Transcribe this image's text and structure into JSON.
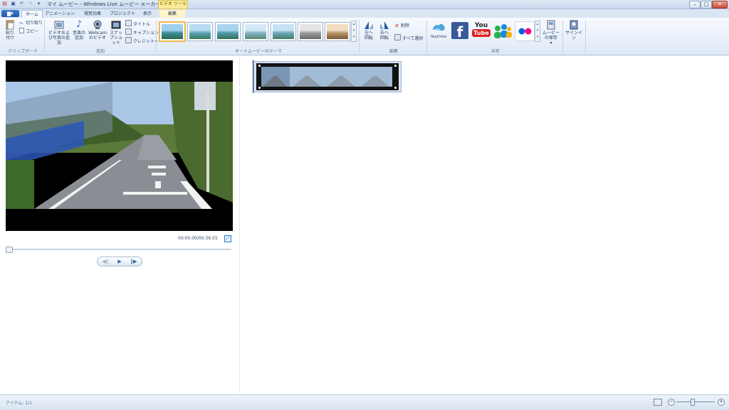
{
  "window": {
    "title": "マイ ムービー - Windows Live ムービー メーカー",
    "context_tab": "ビデオ ツール",
    "controls": {
      "minimize": "–",
      "maximize": "□",
      "close": "✕"
    }
  },
  "quick_access": {
    "save": "▣",
    "undo": "↶",
    "redo": "↷",
    "customize": "▾"
  },
  "tabs": {
    "file": "▆▾",
    "home": "ホーム",
    "animations": "アニメーション",
    "visual_effects": "視覚効果",
    "project": "プロジェクト",
    "view": "表示",
    "edit": "編集"
  },
  "ribbon": {
    "clipboard": {
      "label": "クリップボード",
      "paste": "貼り付け",
      "cut": "切り取り",
      "copy": "コピー"
    },
    "add": {
      "label": "追加",
      "add_videos_photos": "ビデオおよび写真の追加",
      "add_music": "音楽の追加",
      "webcam_video": "Webcam のビデオ",
      "snapshot": "スナップショット",
      "title": "タイトル",
      "caption": "キャプション",
      "credits": "クレジット"
    },
    "automovie": {
      "label": "オートムービーのテーマ"
    },
    "editing": {
      "label": "編集",
      "rotate_left": "左へ回転",
      "rotate_right": "右へ回転",
      "delete": "削除",
      "select_all": "すべて選択"
    },
    "share": {
      "label": "共有",
      "skydrive": "SkyDrive",
      "facebook": "f",
      "youtube_you": "You",
      "youtube_tube": "Tube",
      "save_movie": "ムービーの保存"
    },
    "signin": {
      "label": "サインイン"
    }
  },
  "preview": {
    "timecode": "00:00.00/00:36.55"
  },
  "player": {
    "prev_frame": "◀‖",
    "play": "▶",
    "next_frame": "‖▶"
  },
  "status": {
    "items": "アイテム: 1/1"
  },
  "colors": {
    "accent": "#2b6fcc",
    "ribbon_bg": "#dfe9f6",
    "context_tab": "#fbeb96"
  }
}
